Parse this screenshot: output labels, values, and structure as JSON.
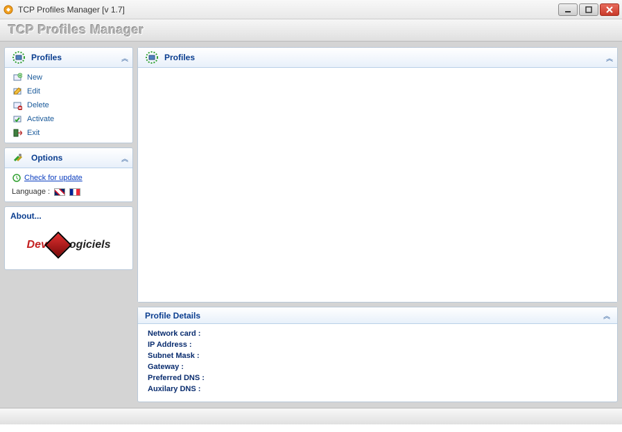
{
  "window": {
    "title": "TCP Profiles Manager [v 1.7]"
  },
  "header": {
    "title": "TCP Profiles Manager"
  },
  "sidebar": {
    "profiles": {
      "title": "Profiles",
      "items": [
        {
          "label": "New"
        },
        {
          "label": "Edit"
        },
        {
          "label": "Delete"
        },
        {
          "label": "Activate"
        },
        {
          "label": "Exit"
        }
      ]
    },
    "options": {
      "title": "Options",
      "check_update": "Check for update",
      "language_label": "Language :"
    },
    "about": {
      "title": "About...",
      "logo1": "Dev",
      "logo2": "ogiciels"
    }
  },
  "main": {
    "profiles": {
      "title": "Profiles"
    },
    "details": {
      "title": "Profile Details",
      "rows": [
        "Network card :",
        "IP Address :",
        "Subnet Mask :",
        "Gateway :",
        "Preferred DNS :",
        "Auxilary DNS :"
      ]
    }
  }
}
